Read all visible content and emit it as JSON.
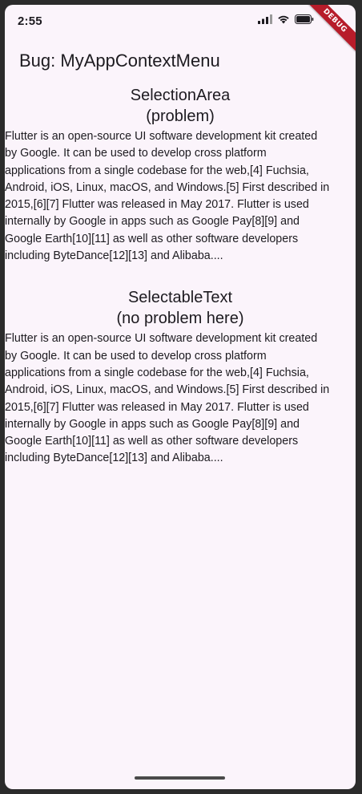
{
  "status_bar": {
    "time": "2:55",
    "ribbon": "DEBUG"
  },
  "app_bar": {
    "title": "Bug: MyAppContextMenu"
  },
  "sections": [
    {
      "heading": "SelectionArea",
      "subheading": "(problem)",
      "lines": [
        "Flutter is an open-source UI software development kit created",
        "by Google. It can be used to develop cross platform",
        "applications from a single codebase for the web,[4] Fuchsia,",
        "Android, iOS, Linux, macOS, and Windows.[5] First described in",
        "2015,[6][7] Flutter was released in May 2017. Flutter is used",
        "internally by Google in apps such as Google Pay[8][9] and",
        "Google Earth[10][11] as well as other software developers",
        "including ByteDance[12][13] and Alibaba...."
      ]
    },
    {
      "heading": "SelectableText",
      "subheading": "(no problem here)",
      "lines": [
        "Flutter is an open-source UI software development kit created",
        "by Google. It can be used to develop cross platform",
        "applications from a single codebase for the web,[4] Fuchsia,",
        "Android, iOS, Linux, macOS, and Windows.[5] First described in",
        "2015,[6][7] Flutter was released in May 2017. Flutter is used",
        "internally by Google in apps such as Google Pay[8][9] and",
        "Google Earth[10][11] as well as other software developers",
        "including ByteDance[12][13] and Alibaba...."
      ]
    }
  ],
  "icons": [
    "signal-icon",
    "wifi-icon",
    "battery-icon"
  ]
}
